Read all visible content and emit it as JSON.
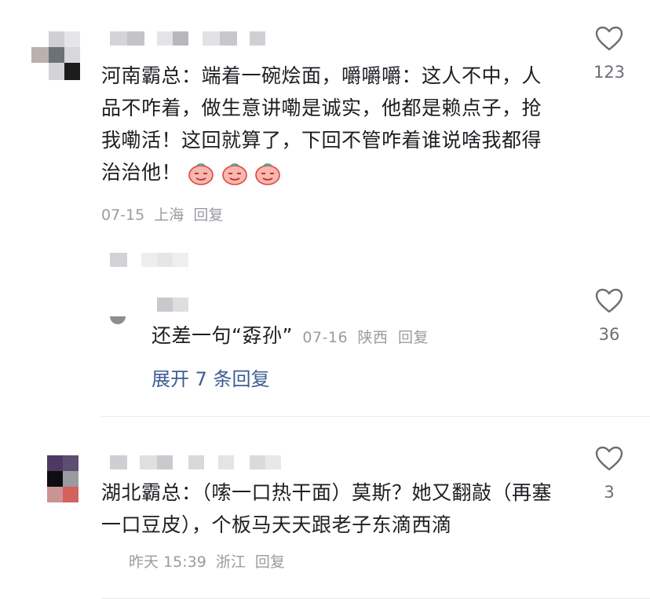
{
  "comments": [
    {
      "text": "河南霸总：端着一碗烩面，嚼嚼嚼：这人不中，人品不咋着，做生意讲嘞是诚实，他都是赖点子，抢我嘞活！这回就算了，下回不管咋着谁说啥我都得治治他！",
      "emoji": [
        "face-emoji",
        "face-emoji",
        "face-emoji"
      ],
      "date": "07-15",
      "location": "上海",
      "reply_label": "回复",
      "likes": "123"
    },
    {
      "text": "还差一句“孬孙”",
      "date": "07-16",
      "location": "陕西",
      "reply_label": "回复",
      "likes": "36",
      "expand_label": "展开 7 条回复"
    },
    {
      "text": "湖北霸总：（嗦一口热干面）莫斯？她又翻敲（再塞一口豆皮），个板马天天跟老子东滴西滴",
      "date": "昨天 15:39",
      "location": "浙江",
      "reply_label": "回复",
      "likes": "3"
    }
  ],
  "colors": {
    "text": "#1e1e23",
    "meta": "#9a9ba1",
    "link": "#3d5c92",
    "divider": "#ebebed"
  }
}
